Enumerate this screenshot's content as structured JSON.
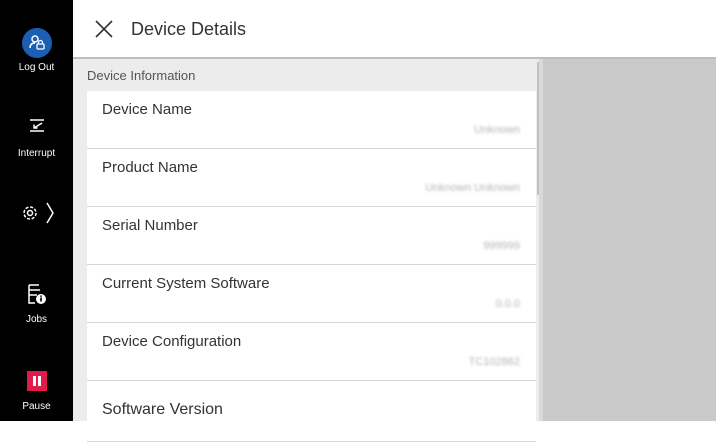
{
  "sidebar": {
    "logout_label": "Log Out",
    "interrupt_label": "Interrupt",
    "jobs_label": "Jobs",
    "pause_label": "Pause"
  },
  "header": {
    "title": "Device Details"
  },
  "section": {
    "label": "Device Information"
  },
  "rows": [
    {
      "label": "Device Name",
      "value": "Unknown"
    },
    {
      "label": "Product Name",
      "value": "Unknown Unknown"
    },
    {
      "label": "Serial Number",
      "value": "999999"
    },
    {
      "label": "Current System Software",
      "value": "0.0.0"
    },
    {
      "label": "Device Configuration",
      "value": "TC102862"
    },
    {
      "label": "Software Version",
      "value": ""
    }
  ],
  "colors": {
    "sidebar_bg": "#000000",
    "logout_accent": "#1a5fb4",
    "pause_accent": "#e01b4b",
    "panel_bg": "#ececec",
    "right_bg": "#c9c9c9"
  }
}
